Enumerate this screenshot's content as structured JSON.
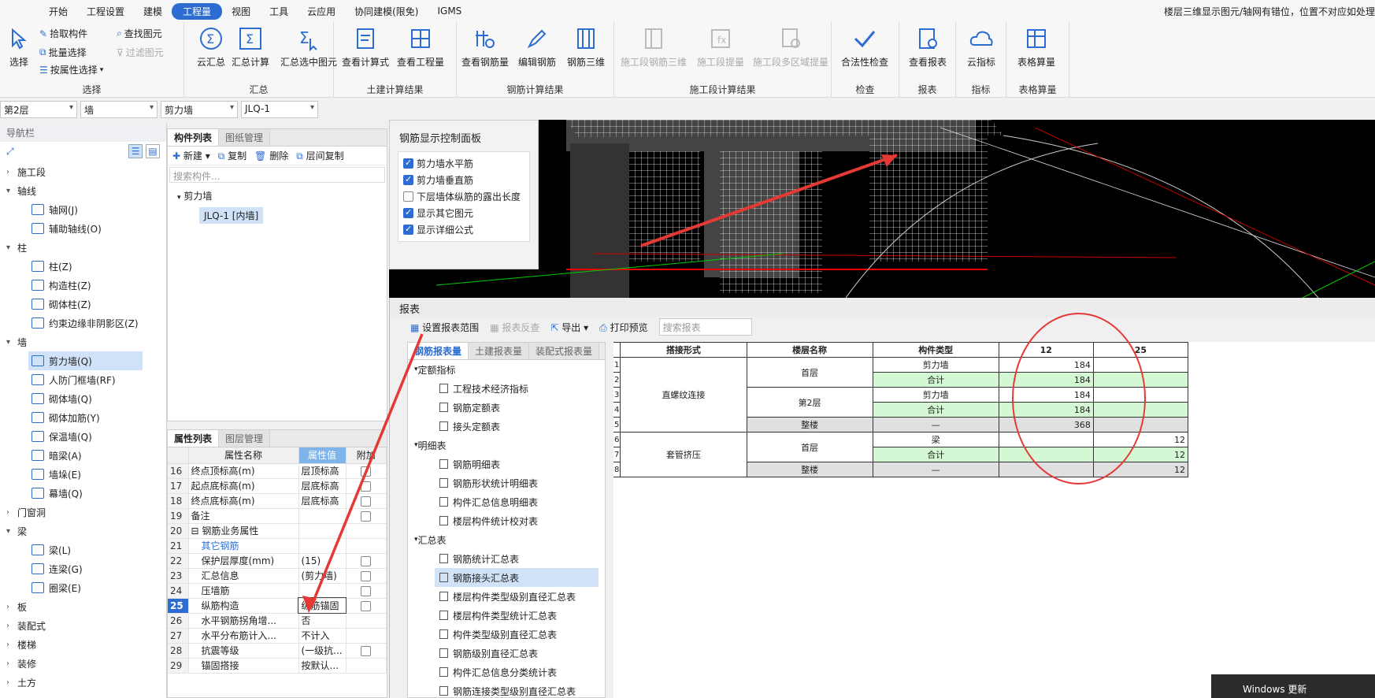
{
  "menu": {
    "items": [
      "开始",
      "工程设置",
      "建模",
      "工程量",
      "视图",
      "工具",
      "云应用",
      "协同建模(限免)",
      "IGMS"
    ],
    "active_index": 3
  },
  "top_note": "楼层三维显示图元/轴网有错位，位置不对应如处理",
  "ribbon": {
    "select": {
      "label": "选择",
      "big": "选择",
      "small": [
        "拾取构件",
        "批量选择",
        "按属性选择",
        "查找图元",
        "过滤图元"
      ]
    },
    "summary": {
      "label": "汇总",
      "buttons": [
        "云汇总",
        "汇总计算",
        "汇总选中图元"
      ]
    },
    "civil": {
      "label": "土建计算结果",
      "buttons": [
        "查看计算式",
        "查看工程量"
      ]
    },
    "rebar": {
      "label": "钢筋计算结果",
      "buttons": [
        "查看钢筋量",
        "编辑钢筋",
        "钢筋三维"
      ]
    },
    "stage": {
      "label": "施工段计算结果",
      "buttons": [
        "施工段钢筋三维",
        "施工段提量",
        "施工段多区域提量"
      ]
    },
    "check": {
      "label": "检查",
      "buttons": [
        "合法性检查"
      ]
    },
    "report": {
      "label": "报表",
      "buttons": [
        "查看报表"
      ]
    },
    "index": {
      "label": "指标",
      "buttons": [
        "云指标"
      ]
    },
    "table": {
      "label": "表格算量",
      "buttons": [
        "表格算量"
      ]
    }
  },
  "combos": [
    "第2层",
    "墙",
    "剪力墙",
    "JLQ-1"
  ],
  "nav": {
    "title": "导航栏",
    "tree": [
      {
        "type": "cat",
        "label": "施工段",
        "open": false
      },
      {
        "type": "cat",
        "label": "轴线",
        "open": true
      },
      {
        "type": "sub",
        "label": "轴网(J)"
      },
      {
        "type": "sub",
        "label": "辅助轴线(O)"
      },
      {
        "type": "cat",
        "label": "柱",
        "open": true
      },
      {
        "type": "sub",
        "label": "柱(Z)"
      },
      {
        "type": "sub",
        "label": "构造柱(Z)"
      },
      {
        "type": "sub",
        "label": "砌体柱(Z)"
      },
      {
        "type": "sub",
        "label": "约束边缘非阴影区(Z)"
      },
      {
        "type": "cat",
        "label": "墙",
        "open": true
      },
      {
        "type": "sub",
        "label": "剪力墙(Q)",
        "selected": true
      },
      {
        "type": "sub",
        "label": "人防门框墙(RF)"
      },
      {
        "type": "sub",
        "label": "砌体墙(Q)"
      },
      {
        "type": "sub",
        "label": "砌体加筋(Y)"
      },
      {
        "type": "sub",
        "label": "保温墙(Q)"
      },
      {
        "type": "sub",
        "label": "暗梁(A)"
      },
      {
        "type": "sub",
        "label": "墙垛(E)"
      },
      {
        "type": "sub",
        "label": "幕墙(Q)"
      },
      {
        "type": "cat",
        "label": "门窗洞",
        "open": false
      },
      {
        "type": "cat",
        "label": "梁",
        "open": true
      },
      {
        "type": "sub",
        "label": "梁(L)"
      },
      {
        "type": "sub",
        "label": "连梁(G)"
      },
      {
        "type": "sub",
        "label": "圈梁(E)"
      },
      {
        "type": "cat",
        "label": "板",
        "open": false
      },
      {
        "type": "cat",
        "label": "装配式",
        "open": false
      },
      {
        "type": "cat",
        "label": "楼梯",
        "open": false
      },
      {
        "type": "cat",
        "label": "装修",
        "open": false
      },
      {
        "type": "cat",
        "label": "土方",
        "open": false
      }
    ]
  },
  "component": {
    "tabs": [
      "构件列表",
      "图纸管理"
    ],
    "tools": [
      "新建",
      "复制",
      "删除",
      "层间复制"
    ],
    "search_placeholder": "搜索构件...",
    "group": "剪力墙",
    "item": "JLQ-1 [内墙]"
  },
  "props": {
    "tabs": [
      "属性列表",
      "图层管理"
    ],
    "headers": [
      "属性名称",
      "属性值",
      "附加"
    ],
    "rows": [
      {
        "n": "16",
        "name": "终点顶标高(m)",
        "val": "层顶标高",
        "chk": true
      },
      {
        "n": "17",
        "name": "起点底标高(m)",
        "val": "层底标高",
        "chk": true
      },
      {
        "n": "18",
        "name": "终点底标高(m)",
        "val": "层底标高",
        "chk": true
      },
      {
        "n": "19",
        "name": "备注",
        "val": "",
        "chk": true
      },
      {
        "n": "20",
        "name": "⊟ 钢筋业务属性",
        "val": "",
        "chk": false
      },
      {
        "n": "21",
        "name": "其它钢筋",
        "val": "",
        "chk": false,
        "blue": true
      },
      {
        "n": "22",
        "name": "保护层厚度(mm)",
        "val": "(15)",
        "chk": true
      },
      {
        "n": "23",
        "name": "汇总信息",
        "val": "(剪力墙)",
        "chk": true
      },
      {
        "n": "24",
        "name": "压墙筋",
        "val": "",
        "chk": true
      },
      {
        "n": "25",
        "name": "纵筋构造",
        "val": "纵筋锚固",
        "chk": true,
        "sel": true
      },
      {
        "n": "26",
        "name": "水平钢筋拐角增...",
        "val": "否",
        "chk": false
      },
      {
        "n": "27",
        "name": "水平分布筋计入...",
        "val": "不计入",
        "chk": false
      },
      {
        "n": "28",
        "name": "抗震等级",
        "val": "(一级抗...",
        "chk": true
      },
      {
        "n": "29",
        "name": "锚固搭接",
        "val": "按默认...",
        "chk": false
      }
    ]
  },
  "ctrl_panel": {
    "title": "钢筋显示控制面板",
    "options": [
      {
        "label": "剪力墙水平筋",
        "on": true
      },
      {
        "label": "剪力墙垂直筋",
        "on": true
      },
      {
        "label": "下层墙体纵筋的露出长度",
        "on": false
      },
      {
        "label": "显示其它图元",
        "on": true
      },
      {
        "label": "显示详细公式",
        "on": true
      }
    ]
  },
  "report": {
    "title": "报表",
    "tools": [
      "设置报表范围",
      "报表反查",
      "导出",
      "打印预览"
    ],
    "search_placeholder": "搜索报表",
    "tabs": [
      "钢筋报表量",
      "土建报表量",
      "装配式报表量"
    ],
    "tree": [
      {
        "type": "grp",
        "label": "定额指标"
      },
      {
        "type": "doc",
        "label": "工程技术经济指标"
      },
      {
        "type": "doc",
        "label": "钢筋定额表"
      },
      {
        "type": "doc",
        "label": "接头定额表"
      },
      {
        "type": "grp",
        "label": "明细表"
      },
      {
        "type": "doc",
        "label": "钢筋明细表"
      },
      {
        "type": "doc",
        "label": "钢筋形状统计明细表"
      },
      {
        "type": "doc",
        "label": "构件汇总信息明细表"
      },
      {
        "type": "doc",
        "label": "楼层构件统计校对表"
      },
      {
        "type": "grp",
        "label": "汇总表"
      },
      {
        "type": "doc",
        "label": "钢筋统计汇总表"
      },
      {
        "type": "doc",
        "label": "钢筋接头汇总表",
        "selected": true
      },
      {
        "type": "doc",
        "label": "楼层构件类型级别直径汇总表"
      },
      {
        "type": "doc",
        "label": "楼层构件类型统计汇总表"
      },
      {
        "type": "doc",
        "label": "构件类型级别直径汇总表"
      },
      {
        "type": "doc",
        "label": "钢筋级别直径汇总表"
      },
      {
        "type": "doc",
        "label": "构件汇总信息分类统计表"
      },
      {
        "type": "doc",
        "label": "钢筋连接类型级别直径汇总表"
      }
    ],
    "table": {
      "headers": [
        "搭接形式",
        "楼层名称",
        "构件类型",
        "12",
        "25"
      ],
      "rows": [
        {
          "n": "1",
          "form": "直螺纹连接",
          "floor": "首层",
          "type": "剪力墙",
          "v12": "184",
          "v25": "",
          "cls": ""
        },
        {
          "n": "2",
          "form": "",
          "floor": "",
          "type": "合计",
          "v12": "184",
          "v25": "",
          "cls": "green"
        },
        {
          "n": "3",
          "form": "",
          "floor": "第2层",
          "type": "剪力墙",
          "v12": "184",
          "v25": "",
          "cls": ""
        },
        {
          "n": "4",
          "form": "",
          "floor": "",
          "type": "合计",
          "v12": "184",
          "v25": "",
          "cls": "green"
        },
        {
          "n": "5",
          "form": "",
          "floor": "整楼",
          "type": "—",
          "v12": "368",
          "v25": "",
          "cls": "gray"
        },
        {
          "n": "6",
          "form": "套管挤压",
          "floor": "首层",
          "type": "梁",
          "v12": "",
          "v25": "12",
          "cls": ""
        },
        {
          "n": "7",
          "form": "",
          "floor": "",
          "type": "合计",
          "v12": "",
          "v25": "12",
          "cls": "green"
        },
        {
          "n": "8",
          "form": "",
          "floor": "整楼",
          "type": "—",
          "v12": "",
          "v25": "12",
          "cls": "gray"
        }
      ]
    }
  },
  "toast": "Windows 更新",
  "colors": {
    "accent": "#2d6dd2",
    "annotation": "#e53935",
    "green_row": "#d4f8d4"
  }
}
